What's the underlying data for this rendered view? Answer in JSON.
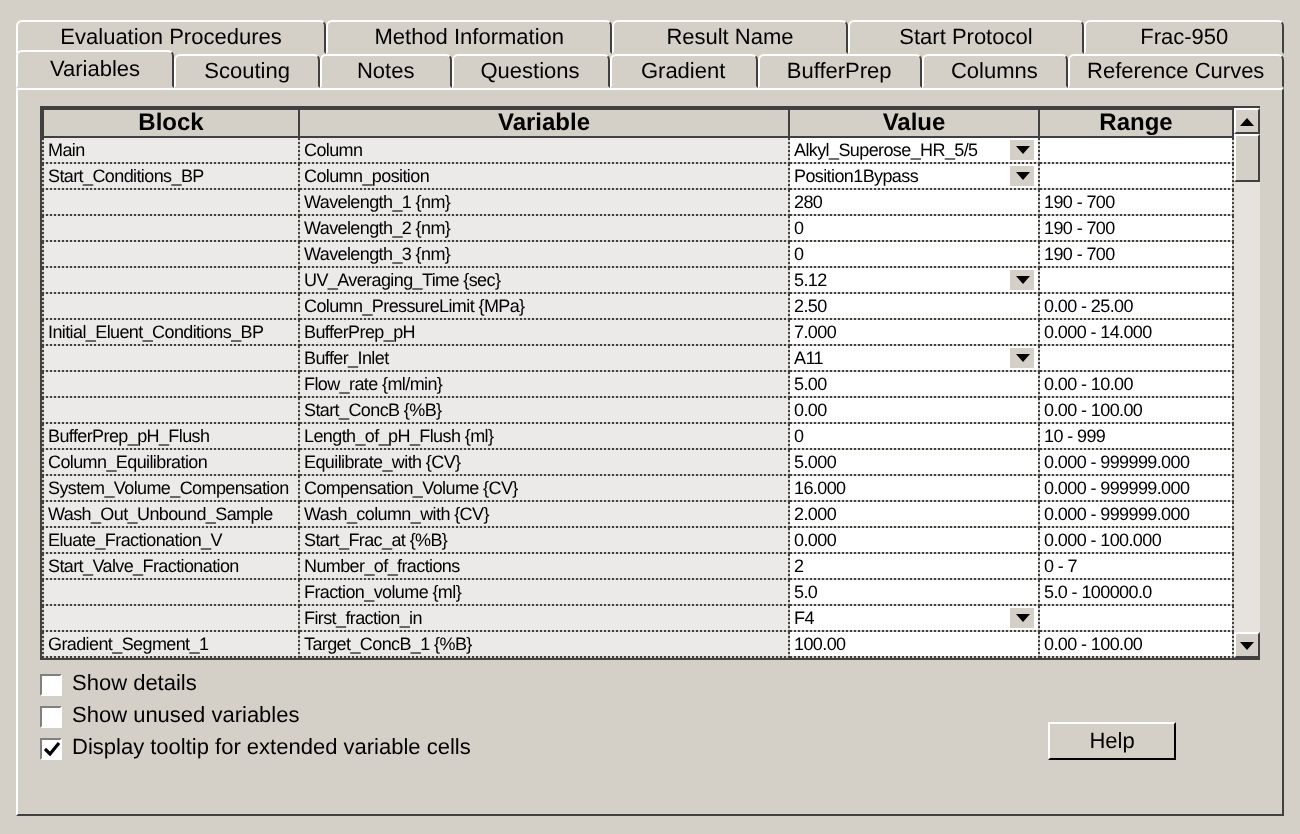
{
  "tab_rows": [
    [
      {
        "label": "Evaluation Procedures",
        "selected": false
      },
      {
        "label": "Method Information",
        "selected": false
      },
      {
        "label": "Result Name",
        "selected": false
      },
      {
        "label": "Start Protocol",
        "selected": false
      },
      {
        "label": "Frac-950",
        "selected": false
      }
    ],
    [
      {
        "label": "Variables",
        "selected": true
      },
      {
        "label": "Scouting",
        "selected": false
      },
      {
        "label": "Notes",
        "selected": false
      },
      {
        "label": "Questions",
        "selected": false
      },
      {
        "label": "Gradient",
        "selected": false
      },
      {
        "label": "BufferPrep",
        "selected": false
      },
      {
        "label": "Columns",
        "selected": false
      },
      {
        "label": "Reference Curves",
        "selected": false
      }
    ]
  ],
  "table": {
    "columns": [
      "Block",
      "Variable",
      "Value",
      "Range"
    ],
    "rows": [
      {
        "block": "Main",
        "variable": "Column",
        "value": "Alkyl_Superose_HR_5/5",
        "kind": "dropdown"
      },
      {
        "block": "Start_Conditions_BP",
        "variable": "Column_position",
        "value": "Position1Bypass",
        "kind": "dropdown"
      },
      {
        "variable": "Wavelength_1 {nm}",
        "value": "280",
        "kind": "text",
        "range": "190 - 700"
      },
      {
        "variable": "Wavelength_2 {nm}",
        "value": "0",
        "kind": "text",
        "range": "190 - 700"
      },
      {
        "variable": "Wavelength_3 {nm}",
        "value": "0",
        "kind": "text",
        "range": "190 - 700"
      },
      {
        "variable": "UV_Averaging_Time {sec}",
        "value": "5.12",
        "kind": "dropdown"
      },
      {
        "variable": "Column_PressureLimit {MPa}",
        "value": "2.50",
        "kind": "text",
        "range": "0.00 - 25.00"
      },
      {
        "block": "Initial_Eluent_Conditions_BP",
        "variable": "BufferPrep_pH",
        "value": "7.000",
        "kind": "text",
        "range": "0.000 - 14.000"
      },
      {
        "variable": "Buffer_Inlet",
        "value": "A11",
        "kind": "dropdown"
      },
      {
        "variable": "Flow_rate {ml/min}",
        "value": "5.00",
        "kind": "text",
        "range": "0.00 - 10.00"
      },
      {
        "variable": "Start_ConcB {%B}",
        "value": "0.00",
        "kind": "text",
        "range": "0.00 - 100.00"
      },
      {
        "block": "BufferPrep_pH_Flush",
        "variable": "Length_of_pH_Flush {ml}",
        "value": "0",
        "kind": "text",
        "range": "10 - 999"
      },
      {
        "block": "Column_Equilibration",
        "variable": "Equilibrate_with {CV}",
        "value": "5.000",
        "kind": "text",
        "range": "0.000 - 999999.000"
      },
      {
        "block": "System_Volume_Compensation",
        "variable": "Compensation_Volume {CV}",
        "value": "16.000",
        "kind": "text",
        "range": "0.000 - 999999.000"
      },
      {
        "block": "Wash_Out_Unbound_Sample",
        "variable": "Wash_column_with {CV}",
        "value": "2.000",
        "kind": "text",
        "range": "0.000 - 999999.000"
      },
      {
        "block": "Eluate_Fractionation_V",
        "variable": "Start_Frac_at {%B}",
        "value": "0.000",
        "kind": "text",
        "range": "0.000 - 100.000"
      },
      {
        "block": "Start_Valve_Fractionation",
        "variable": "Number_of_fractions",
        "value": "2",
        "kind": "text",
        "range": "0 - 7"
      },
      {
        "variable": "Fraction_volume {ml}",
        "value": "5.0",
        "kind": "text",
        "range": "5.0 - 100000.0"
      },
      {
        "variable": "First_fraction_in",
        "value": "F4",
        "kind": "dropdown"
      },
      {
        "block": "Gradient_Segment_1",
        "variable": "Target_ConcB_1 {%B}",
        "value": "100.00",
        "kind": "text",
        "range": "0.00 - 100.00"
      }
    ]
  },
  "options": [
    {
      "label": "Show details",
      "checked": false
    },
    {
      "label": "Show unused variables",
      "checked": false
    },
    {
      "label": "Display tooltip for extended variable cells",
      "checked": true
    }
  ],
  "help_button": "Help"
}
